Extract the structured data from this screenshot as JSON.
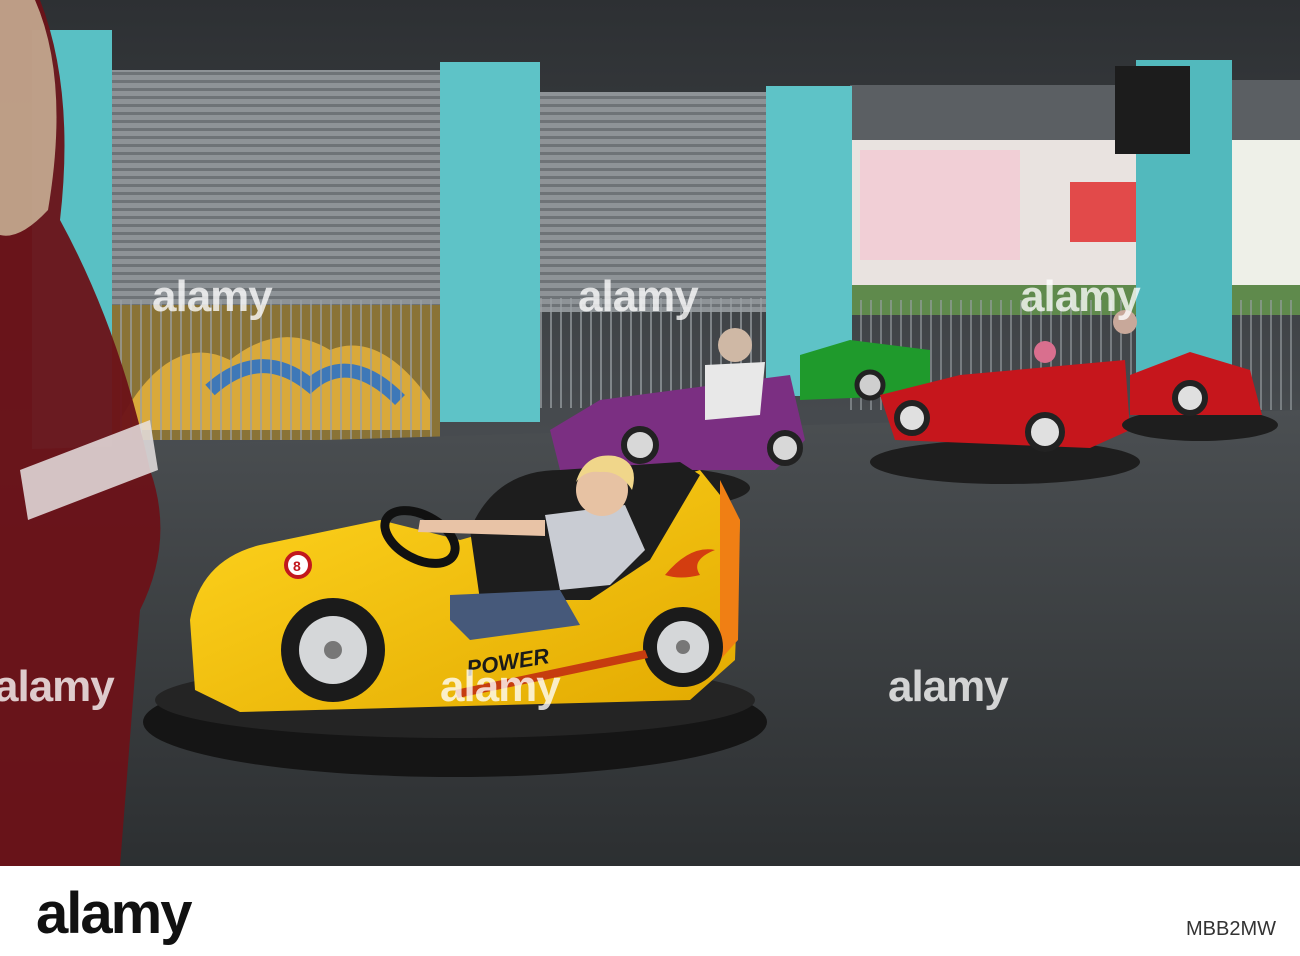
{
  "scene": {
    "car_decal_text": "POWER",
    "car_number": "8"
  },
  "watermark": {
    "text": "alamy"
  },
  "footer": {
    "brand": "alamy",
    "image_id": "MBB2MW"
  },
  "colors": {
    "pillar": "#59c0c4",
    "floor": "#3a3d40",
    "yellow_car": "#f2c500",
    "purple_car": "#7b2f82",
    "red_car": "#c6161c",
    "green_car": "#1f9a2c"
  }
}
